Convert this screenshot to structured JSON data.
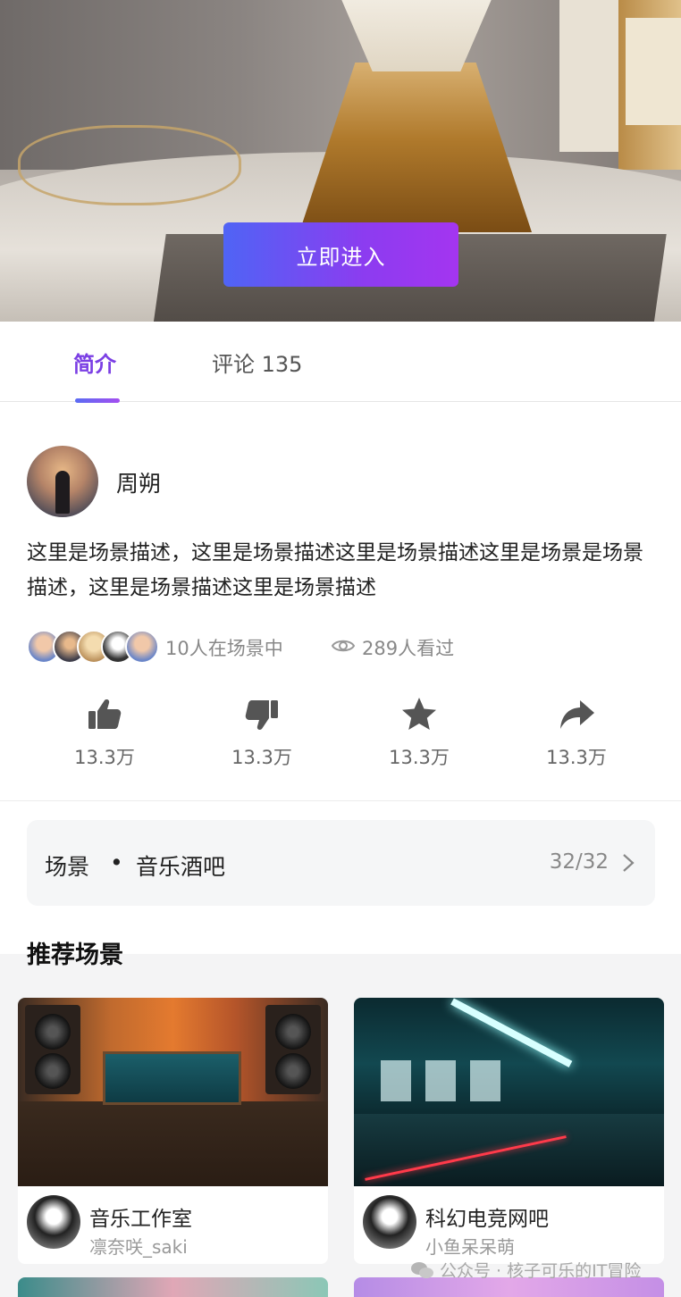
{
  "hero": {
    "enter_button": "立即进入"
  },
  "tabs": [
    {
      "label": "简介"
    },
    {
      "label": "评论 135"
    }
  ],
  "author": {
    "name": "周朔"
  },
  "description": "这里是场景描述，这里是场景描述这里是场景描述这里是场景是场景描述，这里是场景描述这里是场景描述",
  "stats": {
    "in_scene": "10人在场景中",
    "viewed": "289人看过"
  },
  "actions": [
    {
      "icon": "thumbs-up-icon",
      "count": "13.3万"
    },
    {
      "icon": "thumbs-down-icon",
      "count": "13.3万"
    },
    {
      "icon": "star-icon",
      "count": "13.3万"
    },
    {
      "icon": "share-icon",
      "count": "13.3万"
    }
  ],
  "scene": {
    "label": "场景",
    "separator": "•",
    "name": "音乐酒吧",
    "count": "32/32"
  },
  "recommended": {
    "title": "推荐场景",
    "cards": [
      {
        "name": "音乐工作室",
        "author": "凛奈咲_saki"
      },
      {
        "name": "科幻电竞网吧",
        "author": "小鱼呆呆萌"
      }
    ]
  },
  "watermark": "公众号 · 核子可乐的IT冒险",
  "colors": {
    "accent": "#7b3fe4",
    "button_start": "#4f64f5",
    "button_end": "#a435f0"
  }
}
